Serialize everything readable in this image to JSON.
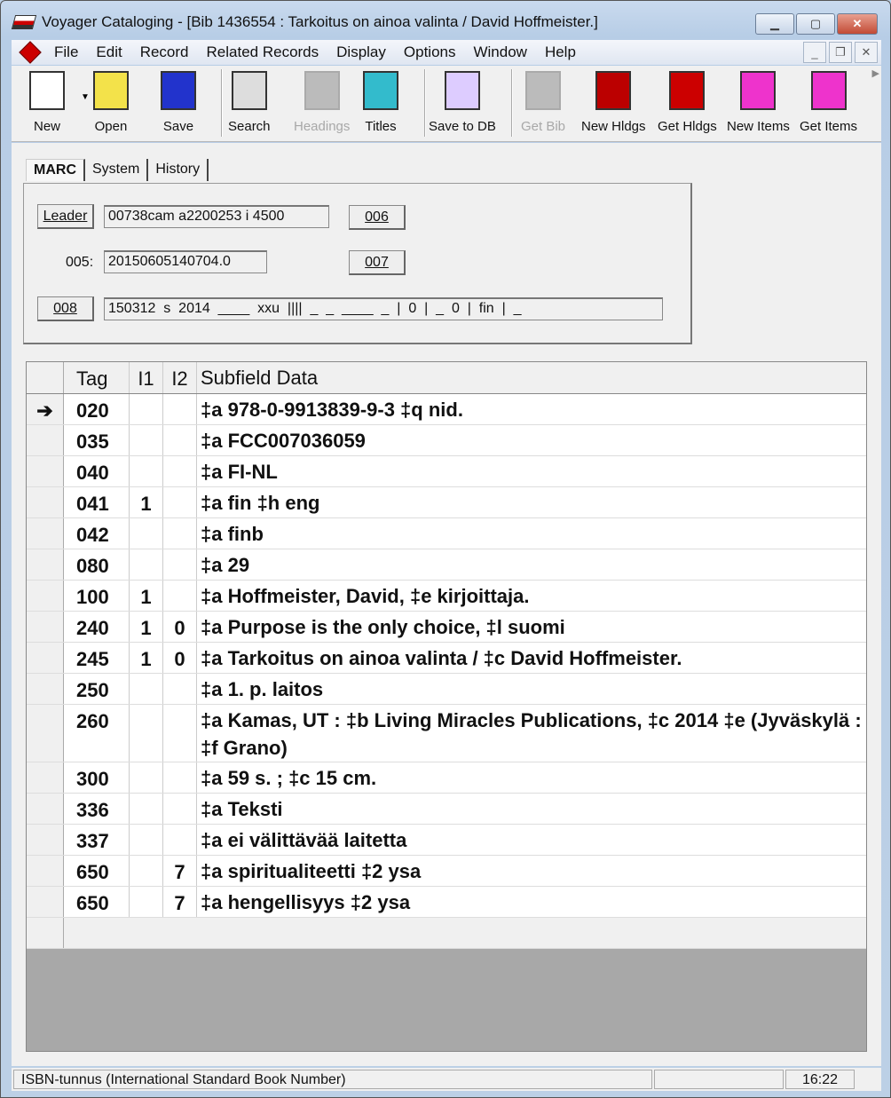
{
  "window": {
    "title": "Voyager Cataloging - [Bib 1436554 : Tarkoitus on ainoa valinta / David Hoffmeister.]"
  },
  "menu": [
    "File",
    "Edit",
    "Record",
    "Related Records",
    "Display",
    "Options",
    "Window",
    "Help"
  ],
  "toolbar": [
    {
      "label": "New",
      "icon": "new-document-icon",
      "enabled": true
    },
    {
      "label": "Open",
      "icon": "folder-icon",
      "enabled": true
    },
    {
      "label": "Save",
      "icon": "floppy-disk-icon",
      "enabled": true
    },
    {
      "label": "Search",
      "icon": "magnifier-icon",
      "enabled": true
    },
    {
      "label": "Headings",
      "icon": "headings-icon",
      "enabled": false
    },
    {
      "label": "Titles",
      "icon": "titles-icon",
      "enabled": true
    },
    {
      "label": "Save to DB",
      "icon": "sailboat-icon",
      "enabled": true
    },
    {
      "label": "Get Bib",
      "icon": "get-bib-icon",
      "enabled": false
    },
    {
      "label": "New Hldgs",
      "icon": "new-holdings-icon",
      "enabled": true
    },
    {
      "label": "Get Hldgs",
      "icon": "get-holdings-icon",
      "enabled": true
    },
    {
      "label": "New Items",
      "icon": "new-items-icon",
      "enabled": true
    },
    {
      "label": "Get Items",
      "icon": "get-items-icon",
      "enabled": true
    }
  ],
  "tabs": [
    "MARC",
    "System",
    "History"
  ],
  "fixed": {
    "leader_label": "Leader",
    "leader_value": "00738cam a2200253 i 4500",
    "btn_006": "006",
    "btn_007": "007",
    "f005_label": "005:",
    "f005_value": "20150605140704.0",
    "btn_008": "008",
    "f008_value": "150312  s  2014  ____  xxu  ||||  _  _  ____  _  |  0  |  _  0  |  fin  |  _"
  },
  "grid": {
    "headers": {
      "tag": "Tag",
      "i1": "I1",
      "i2": "I2",
      "data": "Subfield Data"
    },
    "current_row_marker": "➔",
    "rows": [
      {
        "tag": "020",
        "i1": "",
        "i2": "",
        "data": "‡a 978-0-9913839-9-3 ‡q nid."
      },
      {
        "tag": "035",
        "i1": "",
        "i2": "",
        "data": "‡a FCC007036059"
      },
      {
        "tag": "040",
        "i1": "",
        "i2": "",
        "data": "‡a FI-NL"
      },
      {
        "tag": "041",
        "i1": "1",
        "i2": "",
        "data": "‡a fin ‡h eng"
      },
      {
        "tag": "042",
        "i1": "",
        "i2": "",
        "data": "‡a finb"
      },
      {
        "tag": "080",
        "i1": "",
        "i2": "",
        "data": "‡a 29"
      },
      {
        "tag": "100",
        "i1": "1",
        "i2": "",
        "data": "‡a Hoffmeister, David, ‡e kirjoittaja."
      },
      {
        "tag": "240",
        "i1": "1",
        "i2": "0",
        "data": "‡a Purpose is the only choice, ‡l suomi"
      },
      {
        "tag": "245",
        "i1": "1",
        "i2": "0",
        "data": "‡a Tarkoitus on ainoa valinta / ‡c David Hoffmeister."
      },
      {
        "tag": "250",
        "i1": "",
        "i2": "",
        "data": "‡a 1. p. laitos"
      },
      {
        "tag": "260",
        "i1": "",
        "i2": "",
        "data": "‡a Kamas, UT : ‡b Living Miracles Publications, ‡c 2014 ‡e (Jyväskylä : ‡f Grano)"
      },
      {
        "tag": "300",
        "i1": "",
        "i2": "",
        "data": "‡a 59 s. ; ‡c 15 cm."
      },
      {
        "tag": "336",
        "i1": "",
        "i2": "",
        "data": "‡a Teksti"
      },
      {
        "tag": "337",
        "i1": "",
        "i2": "",
        "data": "‡a ei välittävää laitetta"
      },
      {
        "tag": "650",
        "i1": "",
        "i2": "7",
        "data": "‡a spiritualiteetti ‡2 ysa"
      },
      {
        "tag": "650",
        "i1": "",
        "i2": "7",
        "data": "‡a hengellisyys ‡2 ysa"
      }
    ]
  },
  "status": {
    "message": "ISBN-tunnus (International Standard Book Number)",
    "time": "16:22"
  }
}
